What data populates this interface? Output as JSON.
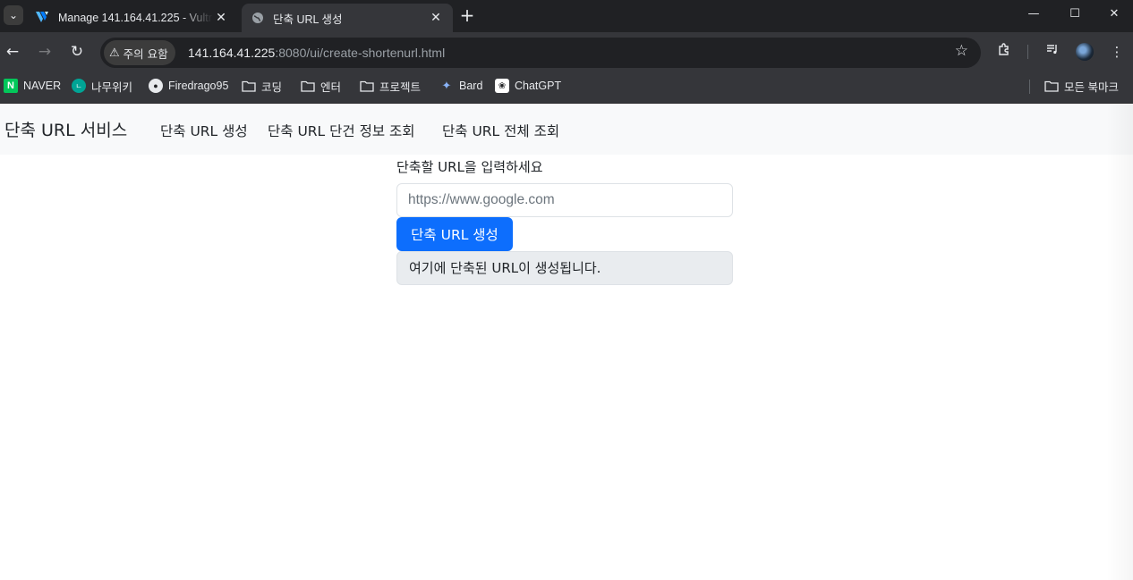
{
  "browser": {
    "tabs": [
      {
        "title": "Manage 141.164.41.225 - Vultr",
        "active": false,
        "favicon": "vultr-logo"
      },
      {
        "title": "단축 URL 생성",
        "active": true,
        "favicon": "globe-icon"
      }
    ],
    "address": {
      "security_label": "주의 요함",
      "host": "141.164.41.225",
      "path": ":8080/ui/create-shortenurl.html"
    },
    "bookmarks": [
      {
        "label": "NAVER",
        "icon": "naver-icon"
      },
      {
        "label": "나무위키",
        "icon": "namuwiki-icon"
      },
      {
        "label": "Firedrago95",
        "icon": "github-icon"
      },
      {
        "label": "코딩",
        "icon": "folder-icon"
      },
      {
        "label": "엔터",
        "icon": "folder-icon"
      },
      {
        "label": "프로젝트",
        "icon": "folder-icon"
      },
      {
        "label": "Bard",
        "icon": "bard-icon"
      },
      {
        "label": "ChatGPT",
        "icon": "chatgpt-icon"
      }
    ],
    "all_bookmarks_label": "모든 북마크"
  },
  "navbar": {
    "brand": "단축 URL 서비스",
    "links": [
      "단축 URL 생성",
      "단축 URL 단건 정보 조회",
      "단축 URL 전체 조회"
    ]
  },
  "form": {
    "label": "단축할 URL을 입력하세요",
    "placeholder": "https://www.google.com",
    "value": "",
    "submit_label": "단축 URL 생성",
    "result_text": "여기에 단축된 URL이 생성됩니다."
  },
  "colors": {
    "primary": "#0d6efd",
    "navbar_bg": "#f8f9fa",
    "result_bg": "#e9ecef"
  }
}
